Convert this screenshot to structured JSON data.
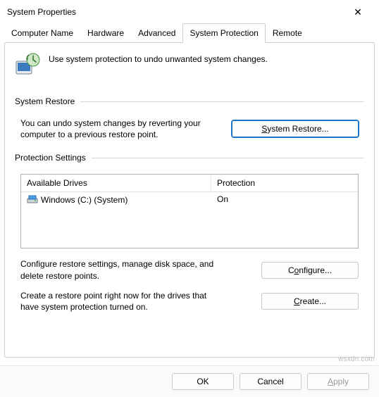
{
  "window": {
    "title": "System Properties",
    "close_glyph": "✕"
  },
  "tabs": {
    "computer_name": "Computer Name",
    "hardware": "Hardware",
    "advanced": "Advanced",
    "system_protection": "System Protection",
    "remote": "Remote"
  },
  "intro": {
    "text": "Use system protection to undo unwanted system changes."
  },
  "groups": {
    "system_restore": {
      "label": "System Restore",
      "desc": "You can undo system changes by reverting your computer to a previous restore point.",
      "button_prefix": "S",
      "button_rest": "ystem Restore..."
    },
    "protection_settings": {
      "label": "Protection Settings",
      "col_drives": "Available Drives",
      "col_protection": "Protection",
      "rows": [
        {
          "drive": "Windows (C:) (System)",
          "protection": "On"
        }
      ],
      "configure_desc": "Configure restore settings, manage disk space, and delete restore points.",
      "configure_prefix": "C",
      "configure_rest": "onfigure...",
      "create_desc": "Create a restore point right now for the drives that have system protection turned on.",
      "create_prefix": "C",
      "create_rest": "reate..."
    }
  },
  "buttons": {
    "ok": "OK",
    "cancel": "Cancel",
    "apply_prefix": "A",
    "apply_rest": "pply"
  },
  "watermark": "wsxdn.com"
}
